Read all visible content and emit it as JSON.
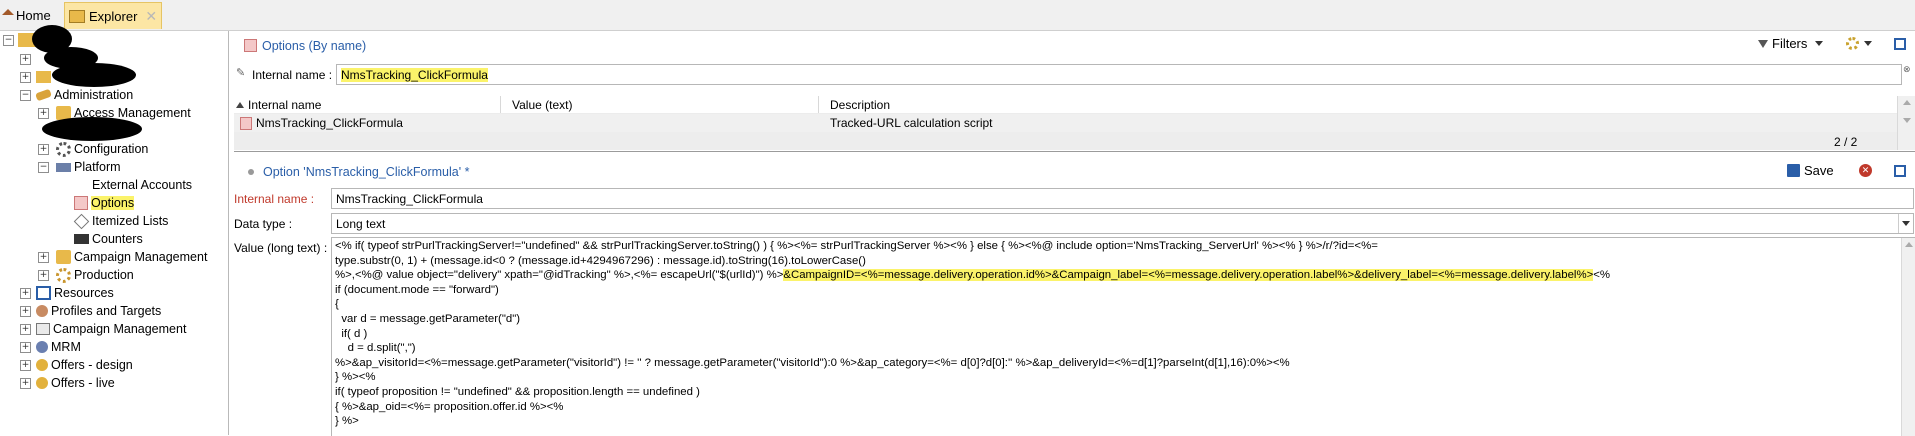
{
  "tabs": [
    {
      "label": "Home"
    },
    {
      "label": "Explorer"
    }
  ],
  "tree": {
    "items": [
      {
        "label": "Administration"
      },
      {
        "label": "Access Management"
      },
      {
        "label": "Configuration"
      },
      {
        "label": "Platform"
      },
      {
        "label": "External Accounts"
      },
      {
        "label": "Options"
      },
      {
        "label": "Itemized Lists"
      },
      {
        "label": "Counters"
      },
      {
        "label": "Campaign Management"
      },
      {
        "label": "Production"
      },
      {
        "label": "Resources"
      },
      {
        "label": "Profiles and Targets"
      },
      {
        "label": "Campaign Management"
      },
      {
        "label": "MRM"
      },
      {
        "label": "Offers - design"
      },
      {
        "label": "Offers - live"
      }
    ]
  },
  "list_panel": {
    "title": "Options (By name)",
    "filters_label": "Filters",
    "filter_label": "Internal name :",
    "filter_value": "NmsTracking_ClickFormula",
    "columns": [
      "Internal name",
      "Value (text)",
      "Description"
    ],
    "rows": [
      {
        "name": "NmsTracking_ClickFormula",
        "value": "",
        "description": "Tracked-URL calculation script"
      }
    ],
    "count": "2 / 2"
  },
  "detail_panel": {
    "title": "Option 'NmsTracking_ClickFormula' *",
    "save_label": "Save",
    "internal_name_label": "Internal name :",
    "internal_name_value": "NmsTracking_ClickFormula",
    "data_type_label": "Data type :",
    "data_type_value": "Long text",
    "value_label": "Value (long text) :",
    "value_lines": [
      "<% if( typeof strPurlTrackingServer!=\"undefined\" && strPurlTrackingServer.toString() ) { %><%= strPurlTrackingServer %><% } else { %><%@ include option='NmsTracking_ServerUrl' %><% } %>/r/?id=<%=",
      "type.substr(0, 1) + (message.id<0 ? (message.id+4294967296) : message.id).toString(16).toLowerCase()",
      "%>,<%@ value object=\"delivery\" xpath=\"@idTracking\" %>,<%= escapeUrl(\"$(urlId)\") %>",
      "if (document.mode == \"forward\")",
      "{",
      "  var d = message.getParameter(\"d\")",
      "  if( d )",
      "    d = d.split(\",\")",
      "%>&ap_visitorId=<%=message.getParameter(\"visitorId\") != '' ? message.getParameter(\"visitorId\"):0 %>&ap_category=<%= d[0]?d[0]:'' %>&ap_deliveryId=<%=d[1]?parseInt(d[1],16):0%><%",
      "} %><%",
      "if( typeof proposition != \"undefined\" && proposition.length == undefined )",
      "{ %>&ap_oid=<%= proposition.offer.id %><%",
      "} %>"
    ],
    "highlighted_fragment": "&CampaignID=<%=message.delivery.operation.id%>&Campaign_label=<%=message.delivery.operation.label%>&delivery_label=<%=message.delivery.label%>",
    "line3_tail": "<%"
  },
  "colors": {
    "highlight": "#fbf36a",
    "link_blue": "#2a5ea8",
    "required_red": "#c0392b"
  }
}
